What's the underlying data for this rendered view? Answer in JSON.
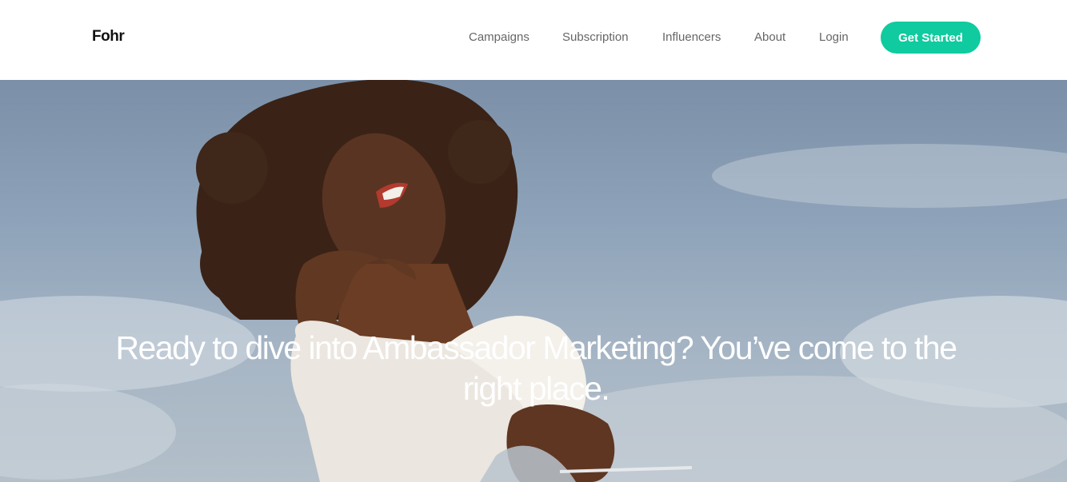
{
  "brand": {
    "logo_text": "Fohr",
    "accent": "#0fcb9f"
  },
  "nav": {
    "links": [
      {
        "label": "Campaigns"
      },
      {
        "label": "Subscription"
      },
      {
        "label": "Influencers"
      },
      {
        "label": "About"
      },
      {
        "label": "Login"
      }
    ],
    "cta_label": "Get Started"
  },
  "hero": {
    "heading": "Ready to dive into Ambassador Marketing? You’ve come to the right place.",
    "image_subject": "woman-with-afro-against-sky"
  }
}
